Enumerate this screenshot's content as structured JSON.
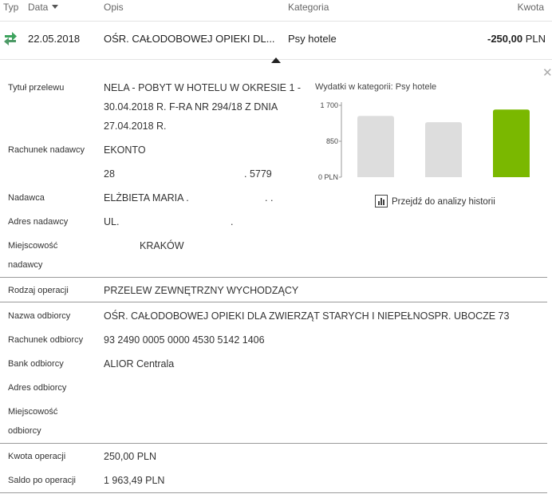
{
  "header": {
    "typ": "Typ",
    "data": "Data",
    "opis": "Opis",
    "kategoria": "Kategoria",
    "kwota": "Kwota"
  },
  "transaction": {
    "date": "22.05.2018",
    "description": "OŚR. CAŁODOBOWEJ OPIEKI DL...",
    "category": "Psy hotele",
    "amount": "-250,00",
    "currency": "PLN"
  },
  "details": {
    "tytul_label": "Tytuł przelewu",
    "tytul_lines": [
      "NELA - POBYT W HOTELU W OKRESIE 1 -",
      "30.04.2018 R. F-RA NR 294/18 Z DNIA",
      "27.04.2018 R."
    ],
    "rachunek_nadawcy_label": "Rachunek nadawcy",
    "rachunek_nadawcy_name": "EKONTO",
    "rachunek_nadawcy_start": "28",
    "rachunek_nadawcy_end": ". 5779",
    "nadawca_label": "Nadawca",
    "nadawca_value": "ELŻBIETA MARIA .",
    "nadawca_trail": ". .",
    "adres_nadawcy_label": "Adres nadawcy",
    "adres_nadawcy_value": "UL.",
    "adres_nadawcy_trail": ".",
    "miejscowosc_nadawcy_label_1": "Miejscowość",
    "miejscowosc_nadawcy_label_2": "nadawcy",
    "miejscowosc_nadawcy_value": "KRAKÓW",
    "rodzaj_label": "Rodzaj operacji",
    "rodzaj_value": "PRZELEW ZEWNĘTRZNY WYCHODZĄCY",
    "nazwa_odbiorcy_label": "Nazwa odbiorcy",
    "nazwa_odbiorcy_value": "OŚR. CAŁODOBOWEJ OPIEKI DLA ZWIERZĄT STARYCH I NIEPEŁNOSPR. UBOCZE 73",
    "rachunek_odbiorcy_label": "Rachunek odbiorcy",
    "rachunek_odbiorcy_value": "93 2490 0005 0000 4530 5142 1406",
    "bank_odbiorcy_label": "Bank odbiorcy",
    "bank_odbiorcy_value": "ALIOR Centrala",
    "adres_odbiorcy_label": "Adres odbiorcy",
    "miejscowosc_odbiorcy_label_1": "Miejscowość",
    "miejscowosc_odbiorcy_label_2": "odbiorcy",
    "kwota_label": "Kwota operacji",
    "kwota_value": "250,00 PLN",
    "saldo_label": "Saldo po operacji",
    "saldo_value": "1 963,49 PLN"
  },
  "chart": {
    "title": "Wydatki w kategorii:  Psy hotele",
    "history_link": "Przejdź do analizy historii"
  },
  "chart_data": {
    "type": "bar",
    "title": "Wydatki w kategorii:  Psy hotele",
    "ylim": [
      0,
      1700
    ],
    "ytick_values": [
      0,
      850,
      1700
    ],
    "ytick_labels": [
      "0 PLN",
      "850",
      "1 700"
    ],
    "values": [
      1450,
      1300,
      1600
    ],
    "colors": [
      "#dddddd",
      "#dddddd",
      "#7ab800"
    ],
    "grid": false
  },
  "colors": {
    "green_accent": "#7ab800",
    "inactive_bar": "#dddddd",
    "transfer_icon": "#3da35d"
  },
  "icons": {
    "type_icon": "transfer-arrows-icon",
    "close": "close-icon",
    "history": "bar-chart-icon"
  }
}
